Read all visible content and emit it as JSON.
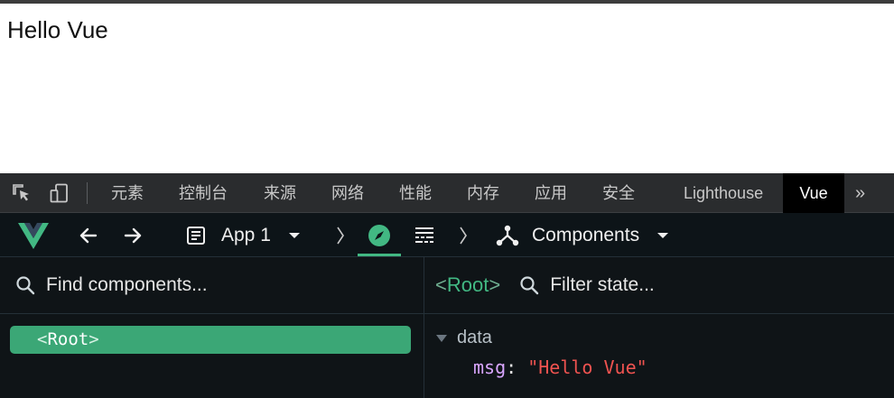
{
  "page": {
    "text": "Hello Vue"
  },
  "devtools_tabs": {
    "elements": "元素",
    "console": "控制台",
    "sources": "来源",
    "network": "网络",
    "performance": "性能",
    "memory": "内存",
    "application": "应用",
    "security": "安全",
    "lighthouse": "Lighthouse",
    "vue": "Vue",
    "more": "»"
  },
  "vue_toolbar": {
    "app_selector": "App 1",
    "mode": "Components"
  },
  "components_panel": {
    "search_placeholder": "Find components...",
    "tree": [
      {
        "open": "<",
        "name": "Root",
        "close": ">"
      }
    ]
  },
  "inspector": {
    "component_name": "Root",
    "open": "<",
    "close": ">",
    "filter_placeholder": "Filter state...",
    "section": "data",
    "state": {
      "key": "msg",
      "colon": ":",
      "value": "\"Hello Vue\""
    }
  },
  "colors": {
    "vue_green": "#42b883",
    "selected_row": "#3ba776",
    "string_value": "#ef5350",
    "key": "#d9a6ff"
  }
}
